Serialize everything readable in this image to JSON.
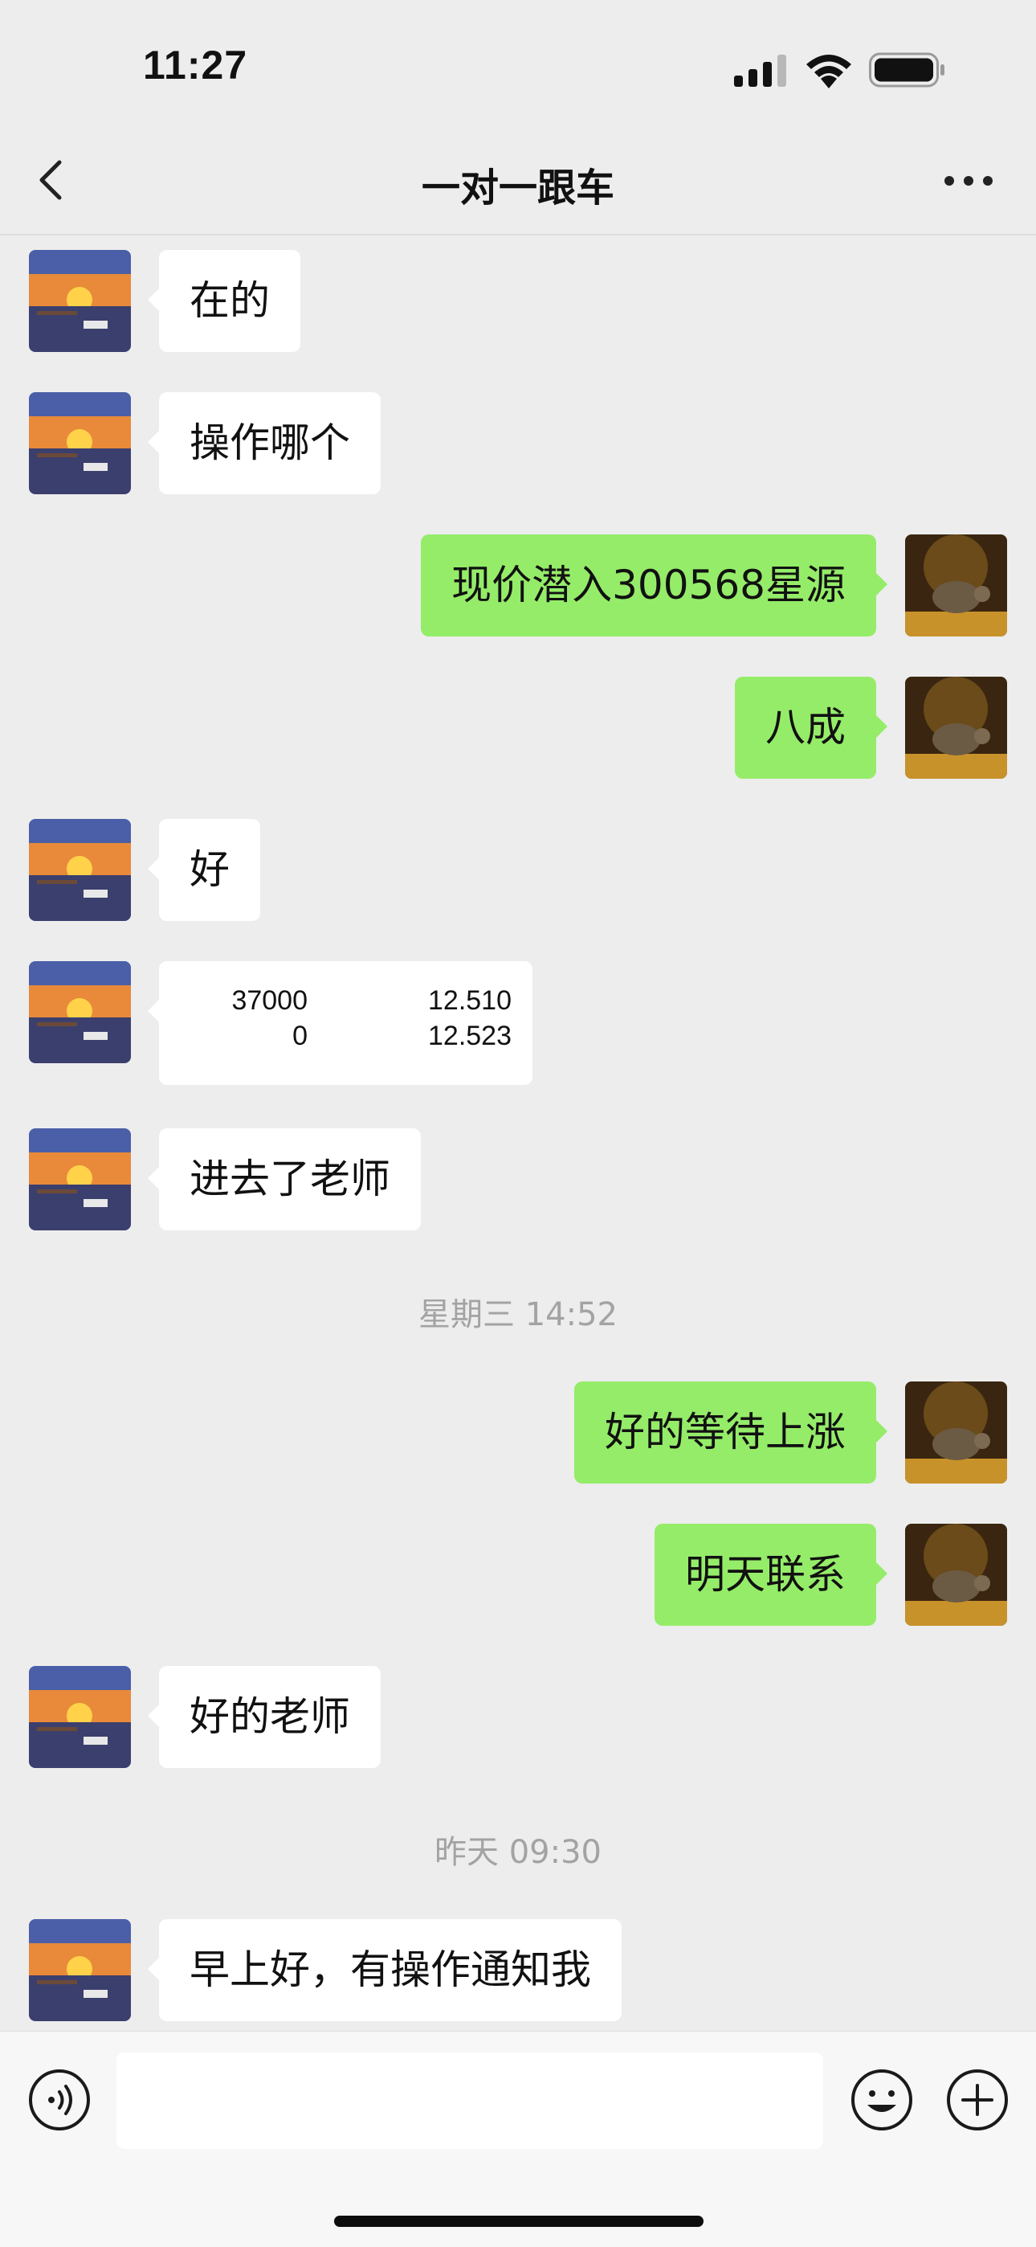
{
  "status_bar": {
    "time": "11:27"
  },
  "nav": {
    "title": "一对一跟车"
  },
  "messages": [
    {
      "side": "in",
      "text": "在的"
    },
    {
      "side": "in",
      "text": "操作哪个"
    },
    {
      "side": "out",
      "text": "现价潜入300568星源"
    },
    {
      "side": "out",
      "text": "八成"
    },
    {
      "side": "in",
      "text": "好"
    },
    {
      "side": "in",
      "type": "quote",
      "rows": [
        [
          "37000",
          "12.510"
        ],
        [
          "0",
          "12.523"
        ]
      ]
    },
    {
      "side": "in",
      "text": "进去了老师"
    },
    {
      "type": "time",
      "text": "星期三 14:52"
    },
    {
      "side": "out",
      "text": "好的等待上涨"
    },
    {
      "side": "out",
      "text": "明天联系"
    },
    {
      "side": "in",
      "text": "好的老师"
    },
    {
      "type": "time",
      "text": "昨天 09:30"
    },
    {
      "side": "in",
      "text": "早上好，有操作通知我"
    }
  ],
  "input_bar": {
    "value": "",
    "placeholder": ""
  },
  "colors": {
    "background": "#ededed",
    "incoming_bubble": "#ffffff",
    "outgoing_bubble": "#95ec69",
    "timestamp": "#a3a3a3"
  },
  "icons": {
    "back": "chevron-left-icon",
    "more": "more-dots-icon",
    "voice": "voice-icon",
    "emoji": "emoji-icon",
    "plus": "plus-icon"
  }
}
